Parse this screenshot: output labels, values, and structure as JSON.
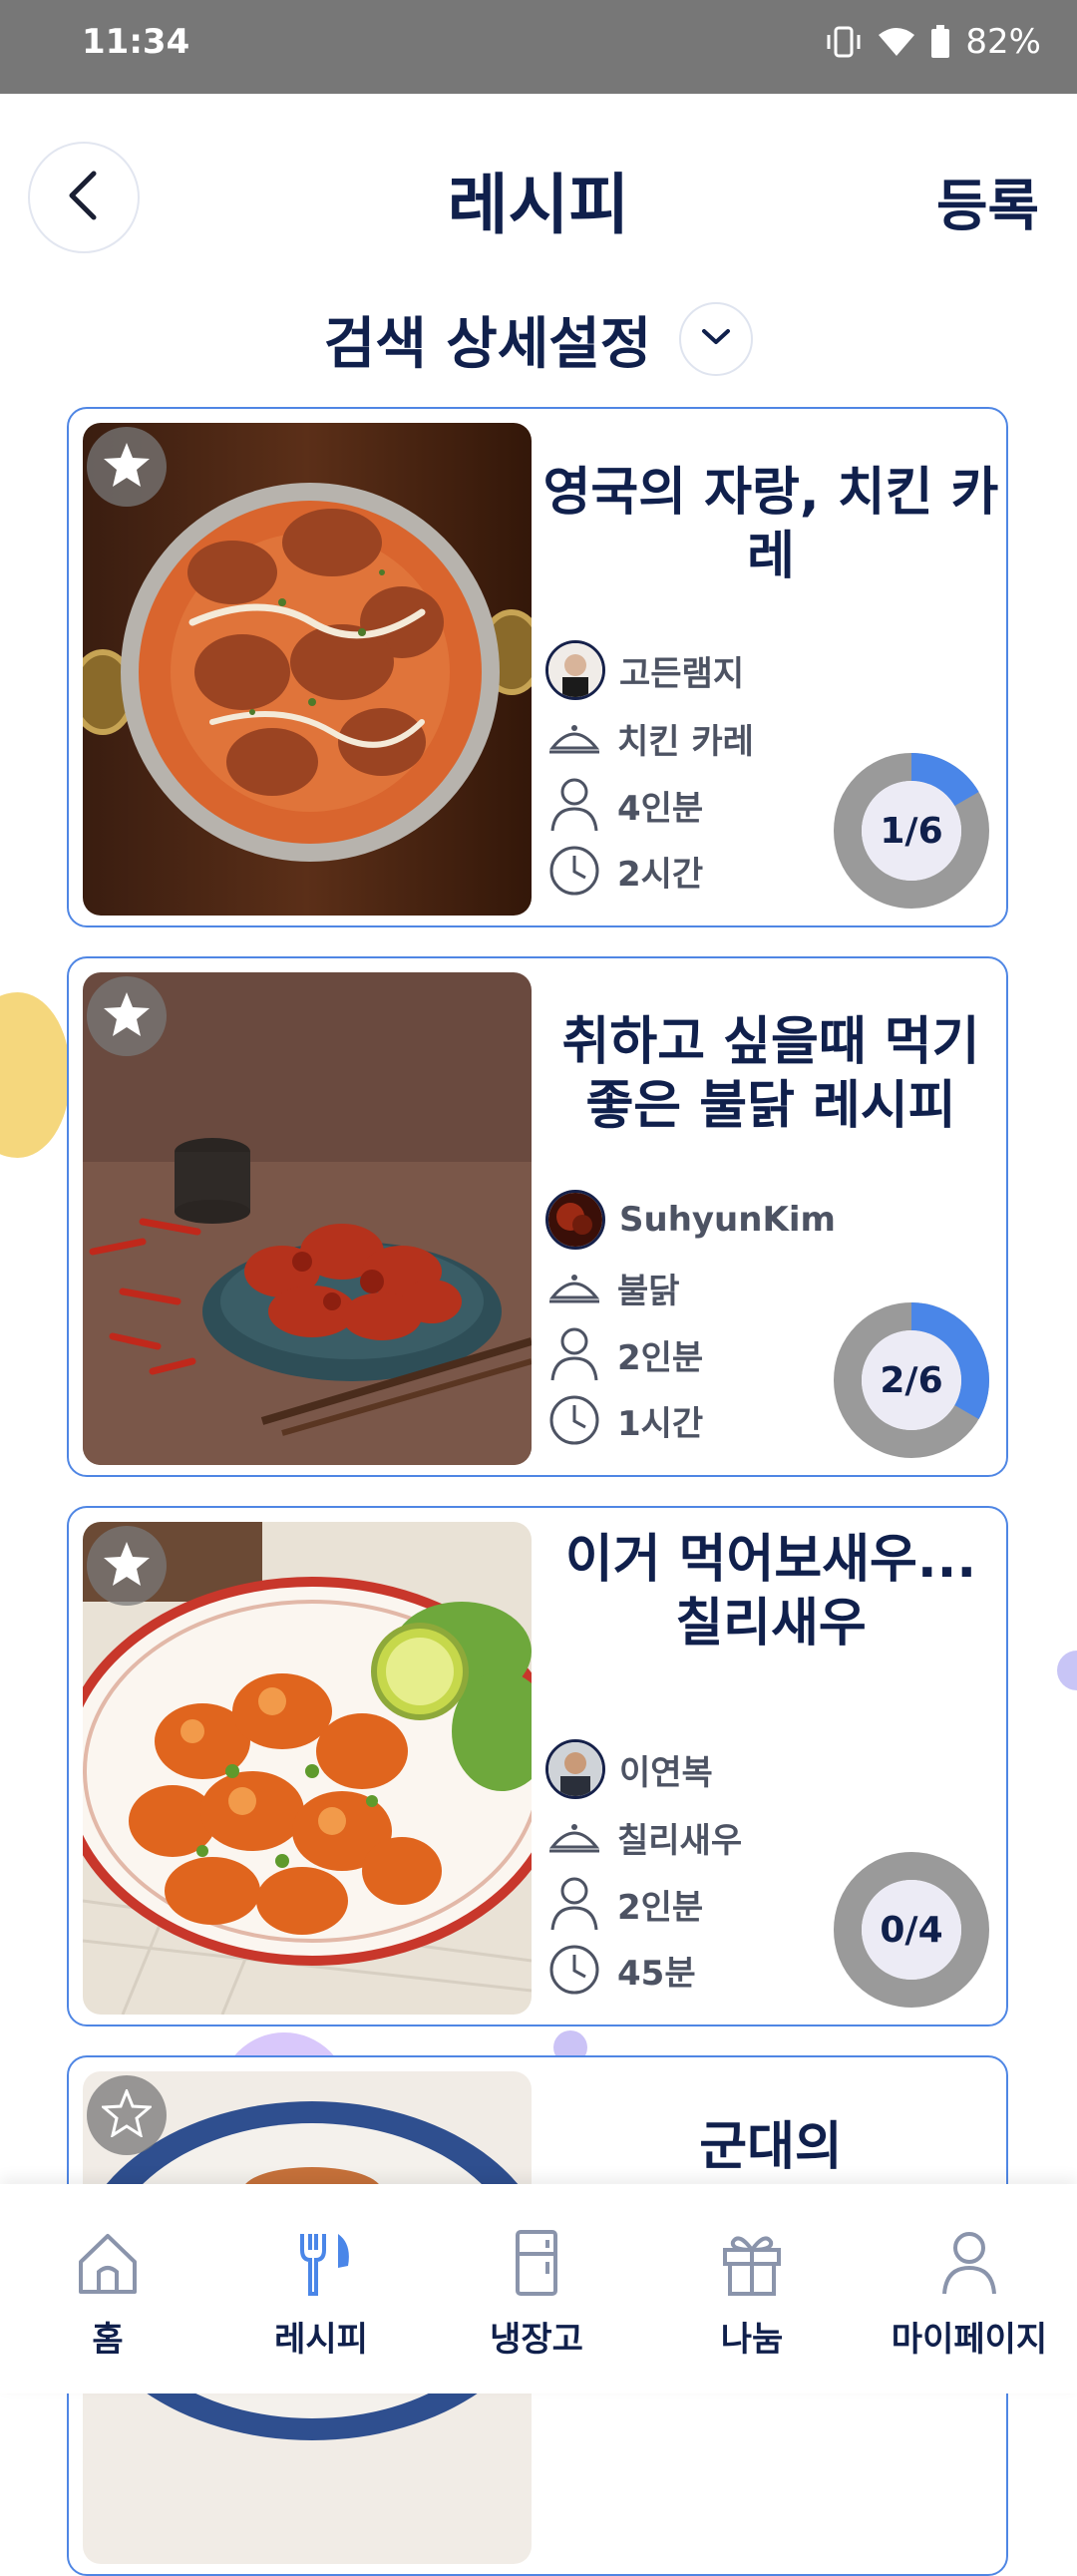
{
  "status_bar": {
    "time": "11:34",
    "battery": "82%"
  },
  "header": {
    "title": "레시피",
    "register_label": "등록"
  },
  "filter": {
    "label": "검색 상세설정"
  },
  "recipes": [
    {
      "title": "영국의 자랑, 치킨 카레",
      "author": "고든램지",
      "dish": "치킨 카레",
      "servings": "4인분",
      "time": "2시간",
      "progress": "1/6",
      "progress_fraction": 0.1667
    },
    {
      "title": "취하고 싶을때 먹기 좋은 불닭 레시피",
      "author": "SuhyunKim",
      "dish": "불닭",
      "servings": "2인분",
      "time": "1시간",
      "progress": "2/6",
      "progress_fraction": 0.3333
    },
    {
      "title": "이거 먹어보새우...칠리새우",
      "author": "이연복",
      "dish": "칠리새우",
      "servings": "2인분",
      "time": "45분",
      "progress": "0/4",
      "progress_fraction": 0
    },
    {
      "title": "군대의"
    }
  ],
  "nav": {
    "items": [
      {
        "label": "홈",
        "icon": "home-icon"
      },
      {
        "label": "레시피",
        "icon": "fork-knife-icon",
        "active": true
      },
      {
        "label": "냉장고",
        "icon": "fridge-icon"
      },
      {
        "label": "나눔",
        "icon": "gift-icon"
      },
      {
        "label": "마이페이지",
        "icon": "person-icon"
      }
    ]
  },
  "colors": {
    "accent": "#4a86e8",
    "navy": "#10204c",
    "border": "#4f86e4",
    "progress_track": "#9a9a9a"
  }
}
